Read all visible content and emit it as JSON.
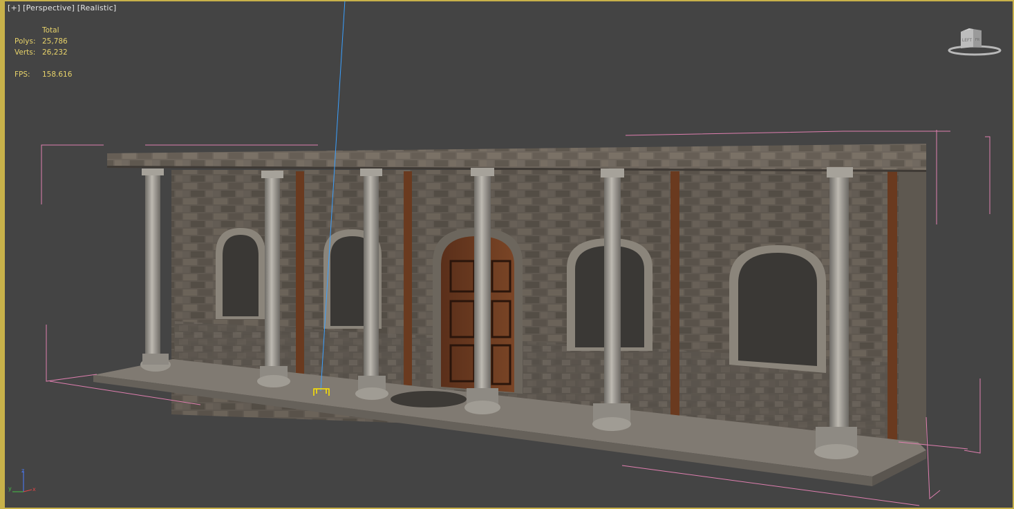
{
  "viewport": {
    "label_plus": "[+]",
    "label_view": "[Perspective]",
    "label_shading": "[Realistic]"
  },
  "stats": {
    "header": "Total",
    "polys_label": "Polys:",
    "polys_value": "25,786",
    "verts_label": "Verts:",
    "verts_value": "26,232",
    "fps_label": "FPS:",
    "fps_value": "158.616"
  },
  "viewcube": {
    "face_left": "LEFT",
    "face_right": "FR"
  },
  "axis_tripod": {
    "x": "x",
    "y": "y",
    "z": "z"
  },
  "colors": {
    "viewport_bg": "#444444",
    "border": "#c8b14a",
    "stats_text": "#e8d36a",
    "bbox": "#e07fb0",
    "gizmo_line": "#3aa0ff",
    "pivot": "#ffe600"
  },
  "icons": [
    "viewcube-icon",
    "axis-tripod-icon",
    "pivot-gizmo-icon"
  ]
}
